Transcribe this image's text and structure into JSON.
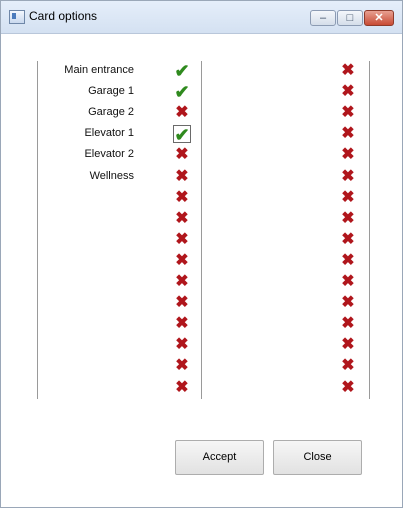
{
  "window": {
    "title": "Card options",
    "controls": {
      "minimize": "‒",
      "maximize": "□",
      "close": "✕"
    }
  },
  "rooms": [
    {
      "label": "Main entrance",
      "col1": "check",
      "col2": "x"
    },
    {
      "label": "Garage 1",
      "col1": "check",
      "col2": "x"
    },
    {
      "label": "Garage 2",
      "col1": "x",
      "col2": "x"
    },
    {
      "label": "Elevator 1",
      "col1": "check",
      "col2": "x",
      "focused": true
    },
    {
      "label": "Elevator 2",
      "col1": "x",
      "col2": "x"
    },
    {
      "label": "Wellness",
      "col1": "x",
      "col2": "x"
    },
    {
      "label": "",
      "col1": "x",
      "col2": "x"
    },
    {
      "label": "",
      "col1": "x",
      "col2": "x"
    },
    {
      "label": "",
      "col1": "x",
      "col2": "x"
    },
    {
      "label": "",
      "col1": "x",
      "col2": "x"
    },
    {
      "label": "",
      "col1": "x",
      "col2": "x"
    },
    {
      "label": "",
      "col1": "x",
      "col2": "x"
    },
    {
      "label": "",
      "col1": "x",
      "col2": "x"
    },
    {
      "label": "",
      "col1": "x",
      "col2": "x"
    },
    {
      "label": "",
      "col1": "x",
      "col2": "x"
    },
    {
      "label": "",
      "col1": "x",
      "col2": "x"
    }
  ],
  "symbols": {
    "check": "✔",
    "x": "✖"
  },
  "buttons": {
    "accept": "Accept",
    "close": "Close"
  }
}
